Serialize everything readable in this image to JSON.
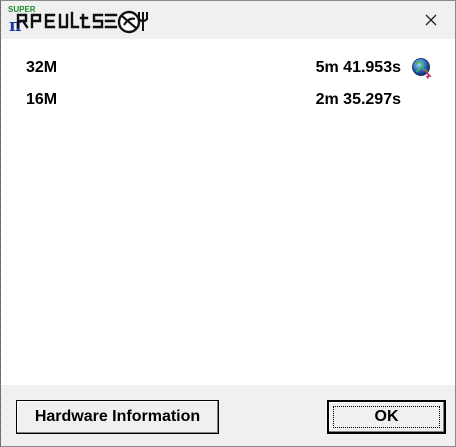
{
  "window": {
    "logo_badge": "SUPER",
    "logo_glyph": "π",
    "logo_text": "Results"
  },
  "results": [
    {
      "size": "32M",
      "time": "5m 41.953s"
    },
    {
      "size": "16M",
      "time": "2m 35.297s"
    }
  ],
  "buttons": {
    "hardware_info": "Hardware Information",
    "ok": "OK"
  },
  "colors": {
    "dialog_bg": "#f0f0f0",
    "content_bg": "#ffffff",
    "logo_green": "#1f8a2b",
    "logo_blue": "#1e3aa8"
  },
  "icons": {
    "title_logo": "super-pi-results-logo",
    "close": "close-icon",
    "record": "globe-icon"
  }
}
